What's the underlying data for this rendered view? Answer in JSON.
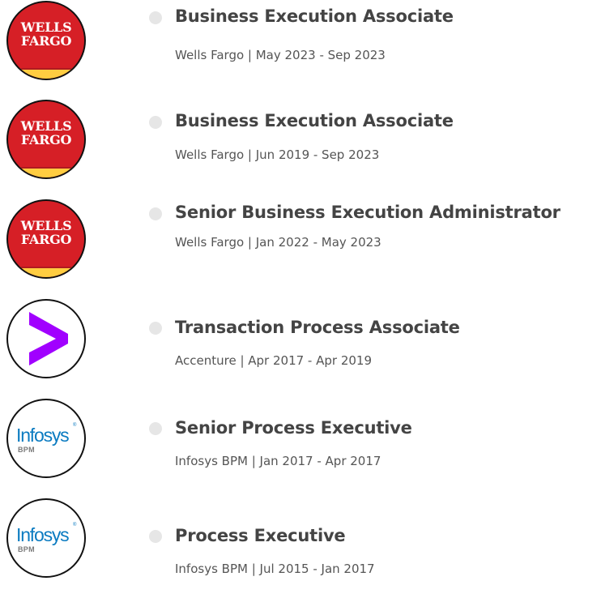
{
  "experience": [
    {
      "company_logo": "Wells Fargo logo",
      "logo_text": [
        "WELLS",
        "FARGO"
      ],
      "title": "Business Execution Associate",
      "meta": "Wells Fargo | May 2023 - Sep 2023"
    },
    {
      "company_logo": "Wells Fargo logo",
      "logo_text": [
        "WELLS",
        "FARGO"
      ],
      "title": "Business Execution Associate",
      "meta": "Wells Fargo | Jun 2019 - Sep 2023"
    },
    {
      "company_logo": "Wells Fargo logo",
      "logo_text": [
        "WELLS",
        "FARGO"
      ],
      "title": "Senior Business Execution Administrator",
      "meta": "Wells Fargo | Jan 2022 - May 2023"
    },
    {
      "company_logo": "Accenture logo",
      "title": "Transaction Process Associate",
      "meta": "Accenture | Apr 2017 - Apr 2019"
    },
    {
      "company_logo": "Infosys BPM logo",
      "logo_text": [
        "Infosys",
        "®",
        "BPM"
      ],
      "title": "Senior Process Executive",
      "meta": "Infosys BPM | Jan 2017 - Apr 2017"
    },
    {
      "company_logo": "Infosys BPM logo",
      "logo_text": [
        "Infosys",
        "®",
        "BPM"
      ],
      "title": "Process Executive",
      "meta": "Infosys BPM | Jul 2015 - Jan 2017"
    }
  ],
  "colors": {
    "wells_fargo_red": "#d61f26",
    "wells_fargo_gold": "#ffcd41",
    "accenture_purple": "#a100ff",
    "infosys_blue": "#0b7bc1",
    "timeline_dot": "#e6e6e6",
    "title_text": "#444444",
    "meta_text": "#555555"
  }
}
